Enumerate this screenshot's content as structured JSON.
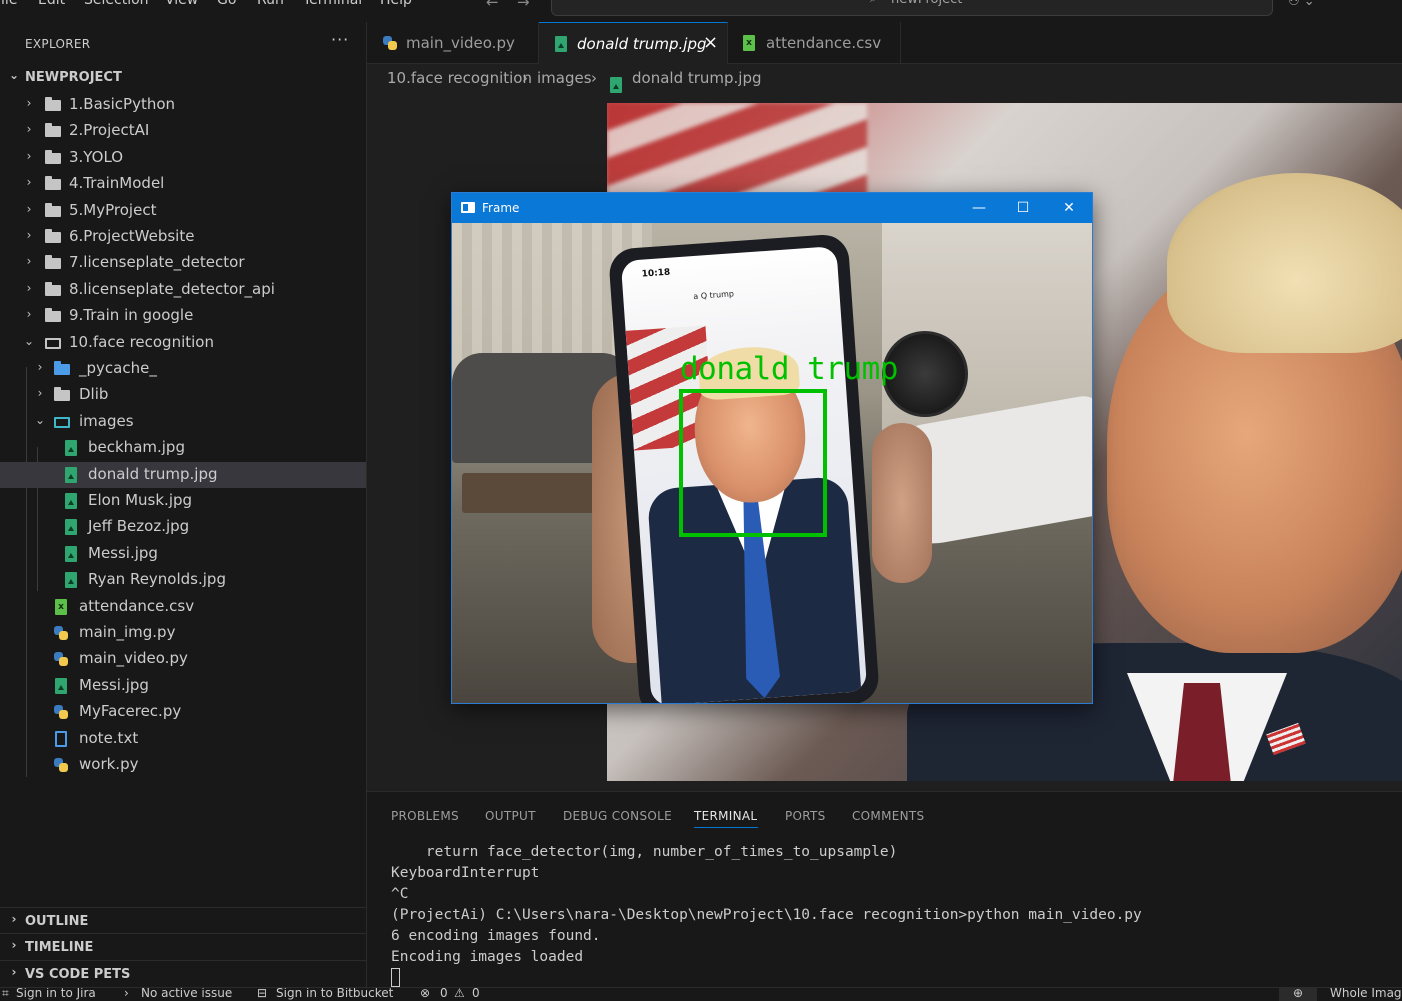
{
  "menu": {
    "items": [
      "File",
      "Edit",
      "Selection",
      "View",
      "Go",
      "Run",
      "Terminal",
      "Help"
    ],
    "search_label": "newProject"
  },
  "sidebar": {
    "header": "EXPLORER",
    "more": "···",
    "project": "NEWPROJECT",
    "tree": [
      {
        "label": "1.BasicPython",
        "kind": "folder"
      },
      {
        "label": "2.ProjectAI",
        "kind": "folder"
      },
      {
        "label": "3.YOLO",
        "kind": "folder"
      },
      {
        "label": "4.TrainModel",
        "kind": "folder"
      },
      {
        "label": "5.MyProject",
        "kind": "folder"
      },
      {
        "label": "6.ProjectWebsite",
        "kind": "folder"
      },
      {
        "label": "7.licenseplate_detector",
        "kind": "folder"
      },
      {
        "label": "8.licenseplate_detector_api",
        "kind": "folder"
      },
      {
        "label": "9.Train in google",
        "kind": "folder"
      },
      {
        "label": "10.face recognition",
        "kind": "folder-open"
      },
      {
        "label": "_pycache_",
        "kind": "folder-blue"
      },
      {
        "label": "Dlib",
        "kind": "folder"
      },
      {
        "label": "images",
        "kind": "folder-images"
      },
      {
        "label": "beckham.jpg",
        "kind": "image"
      },
      {
        "label": "donald trump.jpg",
        "kind": "image",
        "selected": true
      },
      {
        "label": "Elon Musk.jpg",
        "kind": "image"
      },
      {
        "label": "Jeff Bezoz.jpg",
        "kind": "image"
      },
      {
        "label": "Messi.jpg",
        "kind": "image"
      },
      {
        "label": "Ryan Reynolds.jpg",
        "kind": "image"
      },
      {
        "label": "attendance.csv",
        "kind": "csv"
      },
      {
        "label": "main_img.py",
        "kind": "python"
      },
      {
        "label": "main_video.py",
        "kind": "python"
      },
      {
        "label": "Messi.jpg",
        "kind": "image"
      },
      {
        "label": "MyFacerec.py",
        "kind": "python"
      },
      {
        "label": "note.txt",
        "kind": "text"
      },
      {
        "label": "work.py",
        "kind": "python"
      }
    ],
    "sections": [
      "OUTLINE",
      "TIMELINE",
      "VS CODE PETS"
    ]
  },
  "tabs": [
    {
      "label": "main_video.py",
      "active": false
    },
    {
      "label": "donald trump.jpg",
      "active": true
    },
    {
      "label": "attendance.csv",
      "active": false
    }
  ],
  "breadcrumb": [
    "10.face recognition",
    "images",
    "donald trump.jpg"
  ],
  "frame_window": {
    "title": "Frame",
    "face_label": "donald trump",
    "phone_time": "10:18",
    "phone_search": "a Q trump",
    "controls": {
      "minimize": "—",
      "maximize": "☐",
      "close": "✕"
    }
  },
  "panel": {
    "tabs": [
      "PROBLEMS",
      "OUTPUT",
      "DEBUG CONSOLE",
      "TERMINAL",
      "PORTS",
      "COMMENTS"
    ],
    "active_tab": "TERMINAL",
    "terminal_lines": [
      "    return face_detector(img, number_of_times_to_upsample)",
      "KeyboardInterrupt",
      "^C",
      "(ProjectAi) C:\\Users\\nara-\\Desktop\\newProject\\10.face recognition>python main_video.py",
      "6 encoding images found.",
      "Encoding images loaded"
    ]
  },
  "statusbar": {
    "jira": "Sign in to Jira",
    "issue": "No active issue",
    "bitbucket": "Sign in to Bitbucket",
    "errors": "0",
    "warnings": "0",
    "right": "Whole Image"
  },
  "colors": {
    "accent": "#0078d4",
    "detection_box": "#00c000",
    "frame_titlebar": "#0a78d7"
  }
}
